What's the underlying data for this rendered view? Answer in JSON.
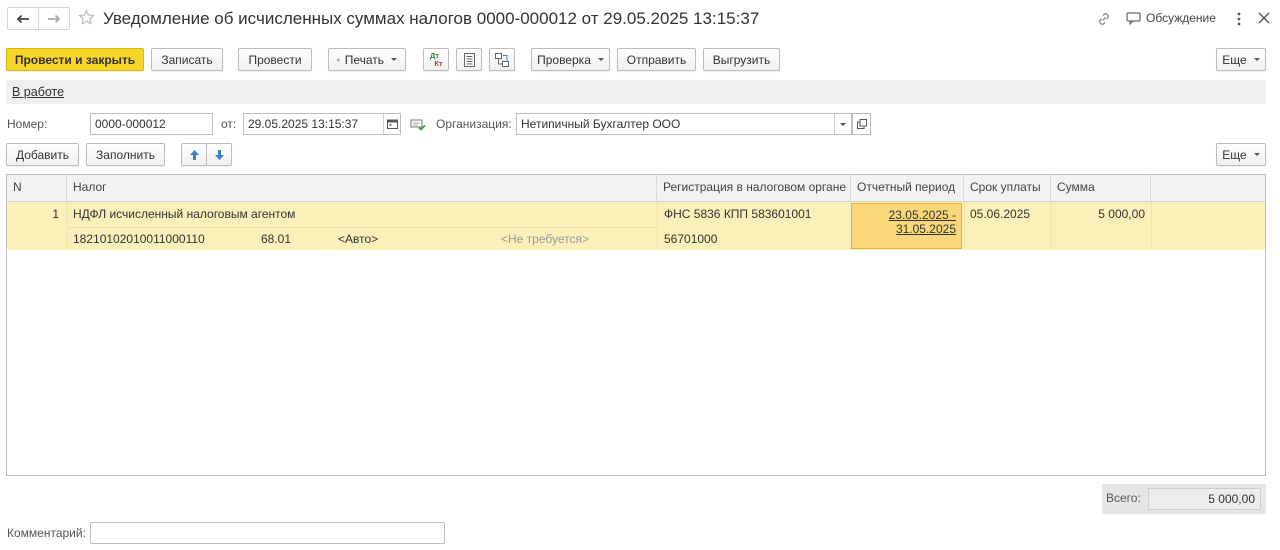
{
  "window": {
    "title": "Уведомление об исчисленных суммах налогов 0000-000012 от 29.05.2025 13:15:37",
    "discussion_label": "Обсуждение"
  },
  "toolbar": {
    "post_close": "Провести и закрыть",
    "save": "Записать",
    "post": "Провести",
    "print": "Печать",
    "check": "Проверка",
    "send": "Отправить",
    "export": "Выгрузить",
    "more": "Еще",
    "dtkt_top": "Дт",
    "dtkt_bottom": "Кт"
  },
  "status": {
    "link": "В работе"
  },
  "form": {
    "number_label": "Номер:",
    "number_value": "0000-000012",
    "date_label": "от:",
    "date_value": "29.05.2025 13:15:37",
    "org_label": "Организация:",
    "org_value": "Нетипичный Бухгалтер ООО"
  },
  "table_toolbar": {
    "add": "Добавить",
    "fill": "Заполнить",
    "more": "Еще"
  },
  "table": {
    "columns": [
      "N",
      "Налог",
      "Регистрация в налоговом органе",
      "Отчетный период",
      "Срок уплаты",
      "Сумма"
    ],
    "rows": [
      {
        "n": "1",
        "tax": "НДФЛ исчисленный налоговым агентом",
        "kbk": "18210102010011000110",
        "account": "68.01",
        "auto": "<Авто>",
        "not_required": "<Не требуется>",
        "registration": "ФНС 5836 КПП 583601001",
        "oktmo": "56701000",
        "period_line1": "23.05.2025 -",
        "period_line2": "31.05.2025",
        "due_date": "05.06.2025",
        "amount": "5 000,00"
      }
    ]
  },
  "totals": {
    "label": "Всего:",
    "value": "5 000,00"
  },
  "comment": {
    "label": "Комментарий:",
    "value": ""
  },
  "colors": {
    "primary_button": "#f6d52a",
    "selected_row": "#fbf0b9",
    "selected_cell": "#f9d77a",
    "arrow_blue": "#3b82c4"
  }
}
